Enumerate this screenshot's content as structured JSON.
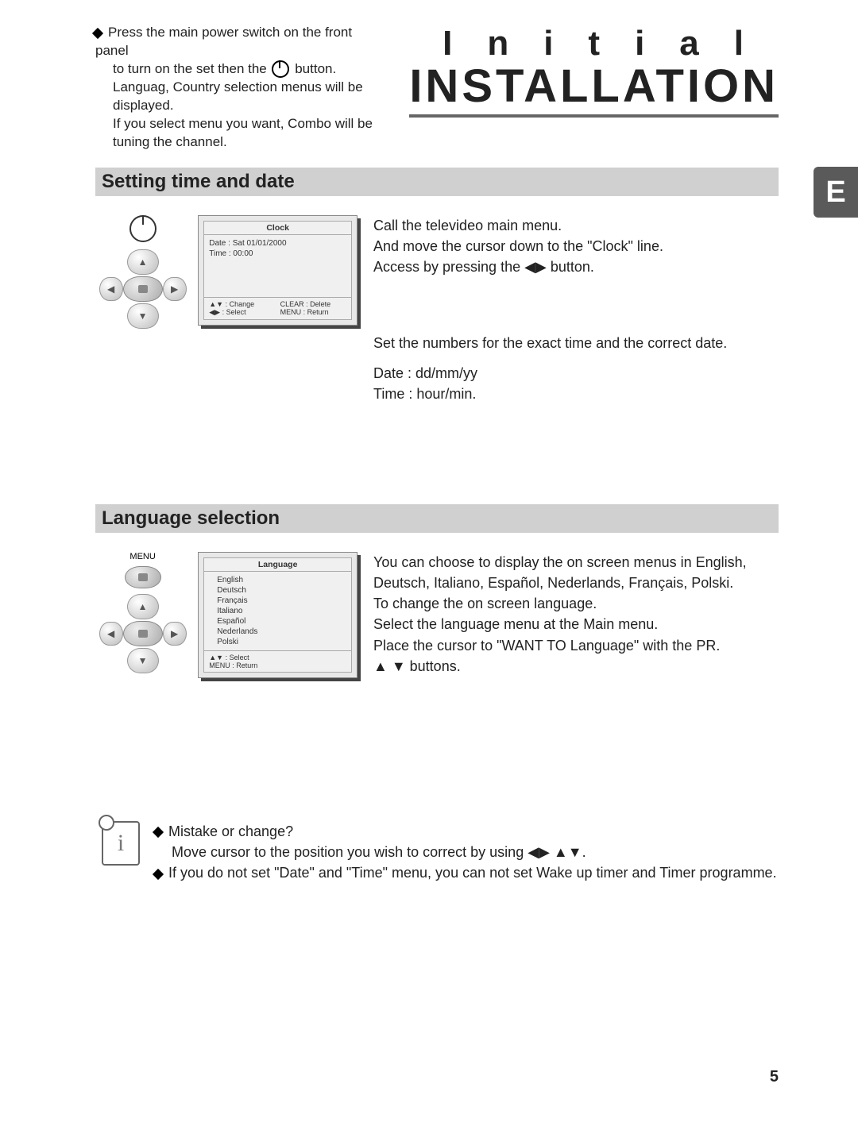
{
  "header": {
    "intro_line1_a": "Press the main power switch on the front panel",
    "intro_line1_b": "to turn on the set then the",
    "intro_line1_c": "button.",
    "intro_line2": "Languag, Country selection menus will be displayed.",
    "intro_line3": "If you select menu you want, Combo will be tuning the channel.",
    "title_small": "Initial",
    "title_big": "INSTALLATION"
  },
  "side_tab": "E",
  "section1": {
    "heading": "Setting time and date",
    "osd": {
      "title": "Clock",
      "line1": "Date : Sat 01/01/2000",
      "line2": "Time : 00:00",
      "foot1": "▲▼ : Change",
      "foot2": "CLEAR : Delete",
      "foot3": "◀▶ : Select",
      "foot4": "MENU : Return"
    },
    "para1_l1": "Call the televideo main menu.",
    "para1_l2": "And move the cursor down to the \"Clock\" line.",
    "para1_l3a": "Access by pressing the",
    "para1_l3b": "◀▶",
    "para1_l3c": "button.",
    "para2_l1": "Set the numbers for the exact time and the correct date.",
    "para2_l2": "Date : dd/mm/yy",
    "para2_l3": "Time : hour/min."
  },
  "section2": {
    "heading": "Language selection",
    "menu_label": "MENU",
    "osd": {
      "title": "Language",
      "items": [
        "English",
        "Deutsch",
        "Français",
        "Italiano",
        "Español",
        "Nederlands",
        "Polski"
      ],
      "foot1": "▲▼    : Select",
      "foot2": "MENU : Return"
    },
    "para_l1": "You can choose to display the on screen menus in English, Deutsch, Italiano, Español, Nederlands, Français, Polski.",
    "para_l2": "To change the on screen language.",
    "para_l3": "Select the language menu at the Main menu.",
    "para_l4": "Place the cursor to \"WANT TO Language\" with the PR.",
    "para_l5a": "▲ ▼",
    "para_l5b": "buttons."
  },
  "note": {
    "l1": "Mistake or change?",
    "l2a": "Move cursor to the position you wish to correct by using",
    "l2b": "◀▶ ▲▼",
    "l2c": ".",
    "l3": "If you do not set \"Date\" and \"Time\" menu, you can not set Wake up timer and Timer programme."
  },
  "page_number": "5"
}
